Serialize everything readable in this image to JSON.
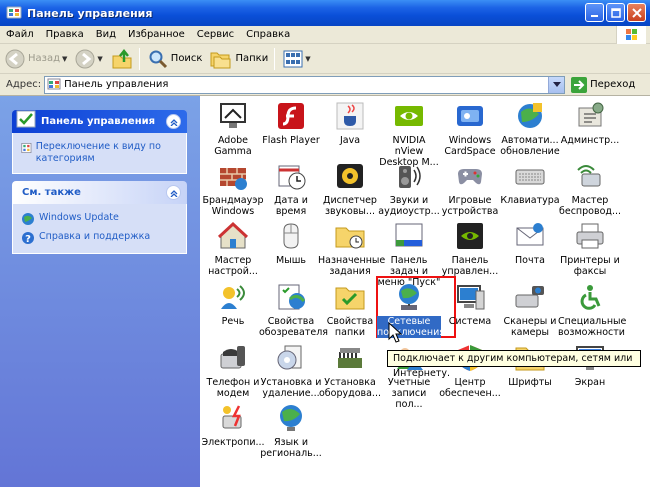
{
  "window": {
    "title": "Панель управления"
  },
  "menu": [
    "Файл",
    "Правка",
    "Вид",
    "Избранное",
    "Сервис",
    "Справка"
  ],
  "toolbar": {
    "back": "Назад",
    "search": "Поиск",
    "folders": "Папки"
  },
  "address": {
    "label": "Адрес:",
    "value": "Панель управления",
    "go": "Переход"
  },
  "taskpane": {
    "control_panel": {
      "title": "Панель управления",
      "links": [
        "Переключение к виду по категориям"
      ]
    },
    "see_also": {
      "title": "См. также",
      "links": [
        "Windows Update",
        "Справка и поддержка"
      ]
    }
  },
  "items": [
    {
      "label": "Adobe Gamma",
      "icon": "monitor-icon"
    },
    {
      "label": "Flash Player",
      "icon": "flash-icon"
    },
    {
      "label": "Java",
      "icon": "java-cup-icon"
    },
    {
      "label": "NVIDIA nView Desktop M...",
      "icon": "nvidia-icon"
    },
    {
      "label": "Windows CardSpace",
      "icon": "cardspace-icon"
    },
    {
      "label": "Автомати... обновление",
      "icon": "globe-update-icon"
    },
    {
      "label": "Админстр...",
      "icon": "admin-tools-icon"
    },
    {
      "label": "Брандмауэр Windows",
      "icon": "firewall-icon"
    },
    {
      "label": "Дата и время",
      "icon": "clock-icon"
    },
    {
      "label": "Диспетчер звуковы...",
      "icon": "sound-manager-icon"
    },
    {
      "label": "Звуки и аудиоустр...",
      "icon": "speaker-icon"
    },
    {
      "label": "Игровые устройства",
      "icon": "gamepad-icon"
    },
    {
      "label": "Клавиатура",
      "icon": "keyboard-icon"
    },
    {
      "label": "Мастер беспровод...",
      "icon": "wireless-icon"
    },
    {
      "label": "Мастер настрой...",
      "icon": "house-icon"
    },
    {
      "label": "Мышь",
      "icon": "mouse-icon"
    },
    {
      "label": "Назначенные задания",
      "icon": "folder-clock-icon"
    },
    {
      "label": "Панель задач и меню \"Пуск\"",
      "icon": "taskbar-icon"
    },
    {
      "label": "Панель управлен...",
      "icon": "nvidia-panel-icon"
    },
    {
      "label": "Почта",
      "icon": "mail-icon"
    },
    {
      "label": "Принтеры и факсы",
      "icon": "printer-icon"
    },
    {
      "label": "Речь",
      "icon": "speech-icon"
    },
    {
      "label": "Свойства обозревателя",
      "icon": "internet-options-icon"
    },
    {
      "label": "Свойства папки",
      "icon": "folder-options-icon"
    },
    {
      "label": "Сетевые подключения",
      "icon": "network-globe-icon"
    },
    {
      "label": "Система",
      "icon": "system-icon"
    },
    {
      "label": "Сканеры и камеры",
      "icon": "scanner-icon"
    },
    {
      "label": "Специальные возможности",
      "icon": "accessibility-icon"
    },
    {
      "label": "Телефон и модем",
      "icon": "phone-icon"
    },
    {
      "label": "Установка и удаление...",
      "icon": "add-remove-icon"
    },
    {
      "label": "Установка оборудова...",
      "icon": "hardware-icon"
    },
    {
      "label": "Учетные записи пол...",
      "icon": "user-accounts-icon"
    },
    {
      "label": "Центр обеспечен...",
      "icon": "security-center-icon"
    },
    {
      "label": "Шрифты",
      "icon": "fonts-icon"
    },
    {
      "label": "Экран",
      "icon": "display-icon"
    },
    {
      "label": "Электропи...",
      "icon": "power-icon"
    },
    {
      "label": "Язык и региональ...",
      "icon": "regional-globe-icon"
    }
  ],
  "tooltip": "Подключает к другим компьютерам, сетям или Интернету."
}
